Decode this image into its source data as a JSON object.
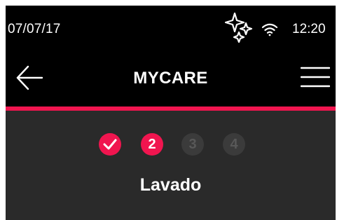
{
  "status_bar": {
    "date": "07/07/17",
    "time": "12:20",
    "icons": [
      "sparkle-icon",
      "wifi-icon"
    ]
  },
  "header": {
    "title": "MYCARE",
    "back_icon": "back-arrow-icon",
    "menu_icon": "hamburger-menu-icon"
  },
  "steps": {
    "items": [
      {
        "label": "",
        "state": "completed",
        "icon": "check-icon"
      },
      {
        "label": "2",
        "state": "current"
      },
      {
        "label": "3",
        "state": "pending"
      },
      {
        "label": "4",
        "state": "pending"
      }
    ],
    "current_step_name": "Lavado"
  },
  "colors": {
    "background": "#000000",
    "panel": "#2a2a2a",
    "accent": "#f0154f",
    "pending_step": "#3b3b3b",
    "pending_text": "#585858",
    "text": "#ffffff"
  }
}
